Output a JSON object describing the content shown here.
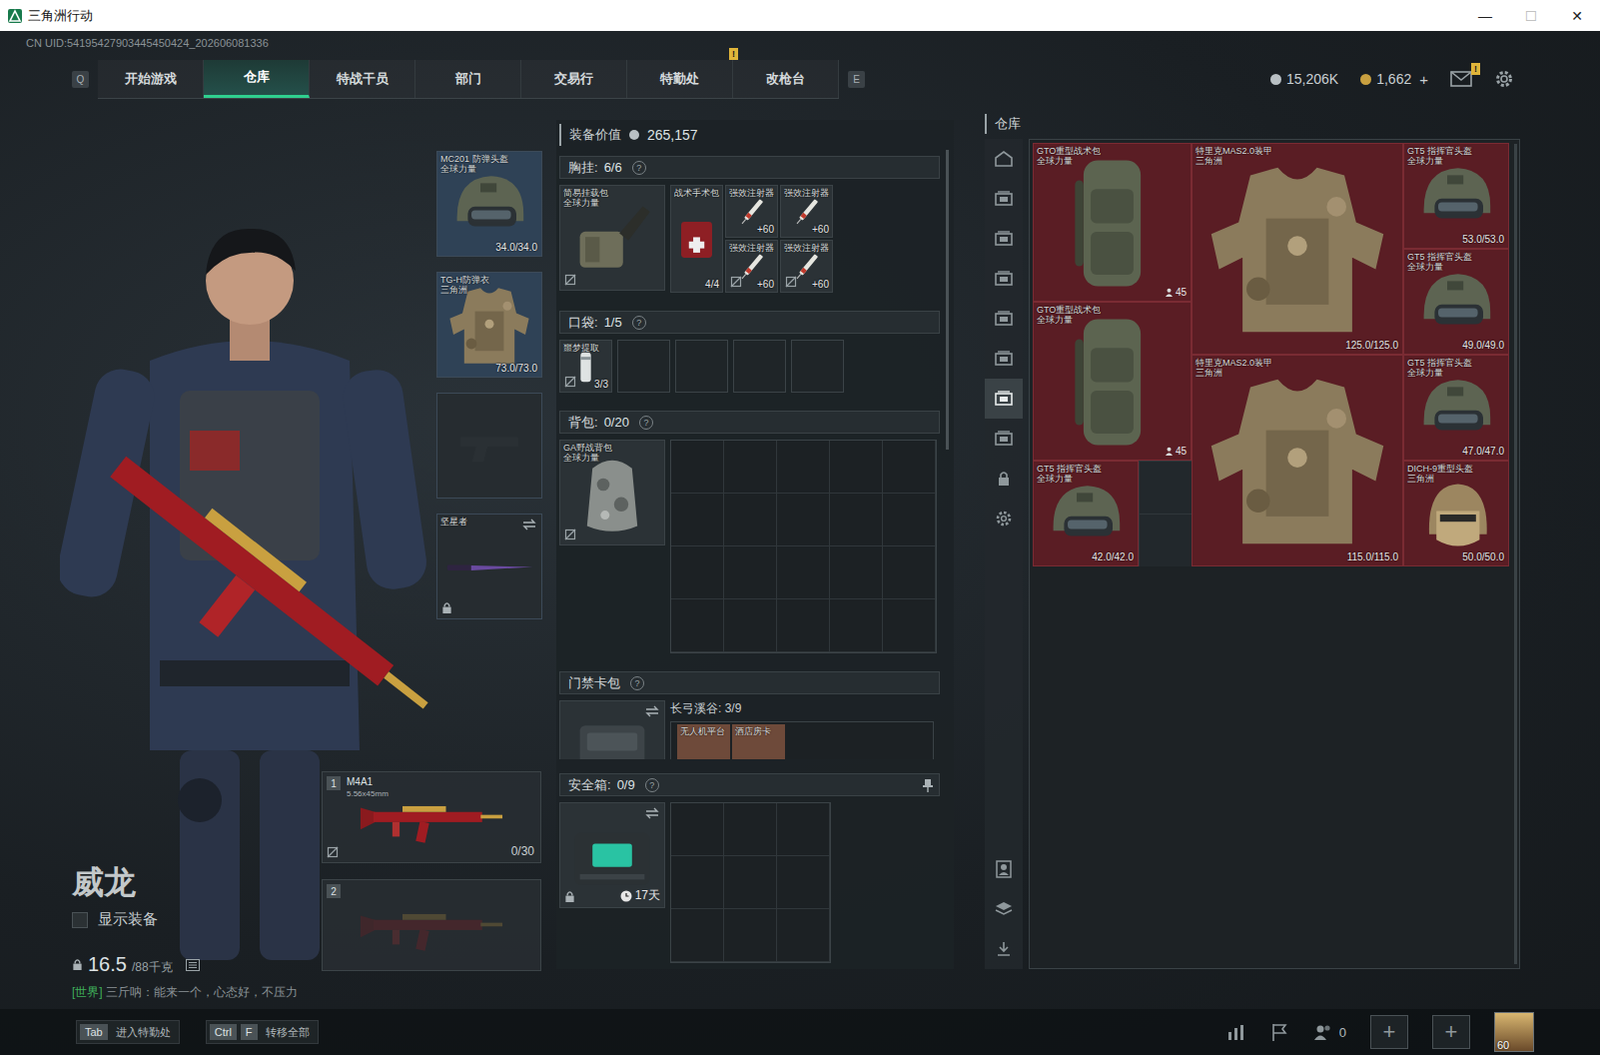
{
  "window": {
    "title": "三角洲行动",
    "controls": [
      {
        "glyph": "—",
        "disabled": false
      },
      {
        "glyph": "☐",
        "disabled": true
      },
      {
        "glyph": "✕",
        "disabled": false
      }
    ]
  },
  "uid": "CN UID:54195427903445450424_202606081336",
  "nav": {
    "prev_key": "Q",
    "next_key": "E",
    "tabs": [
      {
        "label": "开始游戏",
        "selected": false,
        "badge": ""
      },
      {
        "label": "仓库",
        "selected": true,
        "badge": ""
      },
      {
        "label": "特战干员",
        "selected": false,
        "badge": ""
      },
      {
        "label": "部门",
        "selected": false,
        "badge": ""
      },
      {
        "label": "交易行",
        "selected": false,
        "badge": ""
      },
      {
        "label": "特勤处",
        "selected": false,
        "badge": "!"
      },
      {
        "label": "改枪台",
        "selected": false,
        "badge": ""
      }
    ]
  },
  "currency": [
    {
      "kind": "silver",
      "amount": "15,206K",
      "action": ""
    },
    {
      "kind": "gold",
      "amount": "1,662",
      "action": "+"
    }
  ],
  "mail": {
    "badge": "!"
  },
  "character": {
    "name": "威龙",
    "show_gear": {
      "label": "显示装备",
      "checked": false
    },
    "weight": "16.5",
    "weight_max": "/88千克",
    "chat": {
      "channel": "[世界]",
      "text": "三斤呐：能来一个，心态好，不压力"
    }
  },
  "gear_slots": [
    {
      "kind": "helmet",
      "name": "MC201 防弹头盔",
      "sub": "全球力量",
      "reading": "34.0/34.0",
      "empty": false,
      "locked": false,
      "swap": false,
      "color": "#2f4256"
    },
    {
      "kind": "vest",
      "name": "TG-H防弹衣",
      "sub": "三角洲",
      "reading": "73.0/73.0",
      "empty": false,
      "locked": false,
      "swap": false,
      "color": "#2f4256"
    },
    {
      "kind": "pistol",
      "name": "",
      "sub": "",
      "reading": "",
      "empty": true,
      "locked": false,
      "swap": false,
      "color": "#262c30"
    },
    {
      "kind": "knife",
      "name": "坚星者",
      "sub": "",
      "reading": "",
      "empty": false,
      "locked": true,
      "swap": true,
      "color": "#262c30"
    }
  ],
  "weapons": [
    {
      "slot": "1",
      "name": "M4A1",
      "caliber": "5.56x45mm",
      "ammo": "0/30",
      "empty": false,
      "unsecured": true
    },
    {
      "slot": "2",
      "name": "",
      "caliber": "",
      "ammo": "",
      "empty": true,
      "unsecured": false
    }
  ],
  "loadout": {
    "value_label": "装备价值",
    "value": "265,157",
    "chest": {
      "label": "胸挂:",
      "count": "6/6",
      "help": "?",
      "container": {
        "name": "简易挂载包",
        "sub": "全球力量",
        "kind": "rig",
        "unsecured": true
      },
      "items": [
        {
          "name": "战术手术包",
          "kind": "medkit",
          "count": "4/4",
          "unsecured": false
        },
        {
          "name": "强效注射器",
          "kind": "injector",
          "count": "+60",
          "unsecured": false
        },
        {
          "name": "强效注射器",
          "kind": "injector",
          "count": "+60",
          "unsecured": false
        },
        {
          "name": "强效注射器",
          "kind": "injector",
          "count": "+60",
          "unsecured": true
        },
        {
          "name": "强效注射器",
          "kind": "injector",
          "count": "+60",
          "unsecured": true
        }
      ]
    },
    "pocket": {
      "label": "口袋:",
      "count": "1/5",
      "help": "?",
      "items": [
        {
          "name": "噩梦提取",
          "kind": "tube",
          "count": "3/3",
          "unsecured": true
        }
      ],
      "empty_slots": 4
    },
    "backpack": {
      "label": "背包:",
      "count": "0/20",
      "help": "?",
      "container": {
        "name": "GA野战背包",
        "sub": "全球力量",
        "kind": "field-pack",
        "unsecured": true
      },
      "empty_slots": 20
    },
    "keycards": {
      "label": "门禁卡包",
      "help": "?",
      "swap": true,
      "map": "长弓溪谷: 3/9",
      "cards": [
        {
          "name": "无人机平台"
        },
        {
          "name": "酒店房卡"
        }
      ]
    },
    "safe": {
      "label": "安全箱:",
      "count": "0/9",
      "help": "?",
      "timer": "17天",
      "locked": true,
      "swap": true,
      "pinned": true,
      "empty_slots": 9
    }
  },
  "warehouse": {
    "title": "仓库",
    "sidebar": [
      {
        "kind": "home",
        "selected": false
      },
      {
        "kind": "page",
        "selected": false
      },
      {
        "kind": "page",
        "selected": false
      },
      {
        "kind": "page",
        "selected": false
      },
      {
        "kind": "page",
        "selected": false
      },
      {
        "kind": "page",
        "selected": false
      },
      {
        "kind": "page",
        "selected": true
      },
      {
        "kind": "page",
        "selected": false
      },
      {
        "kind": "lock",
        "selected": false
      },
      {
        "kind": "settings",
        "selected": false
      }
    ],
    "sidebar_bottom": [
      {
        "kind": "operator"
      },
      {
        "kind": "layers"
      },
      {
        "kind": "transfer"
      }
    ],
    "items": [
      {
        "name": "GTO重型战术包",
        "sub": "全球力量",
        "kind": "backpack",
        "reading": "",
        "badge": "45",
        "color": "#5a1d24"
      },
      {
        "name": "特里克MAS2.0装甲",
        "sub": "三角洲",
        "kind": "armor",
        "reading": "125.0/125.0",
        "badge": "",
        "color": "#5a1d24"
      },
      {
        "name": "GT5 指挥官头盔",
        "sub": "全球力量",
        "kind": "helmet",
        "reading": "53.0/53.0",
        "badge": "",
        "color": "#5a1d24"
      },
      {
        "name": "GT5 指挥官头盔",
        "sub": "全球力量",
        "kind": "helmet",
        "reading": "49.0/49.0",
        "badge": "",
        "color": "#5a1d24"
      },
      {
        "name": "GTO重型战术包",
        "sub": "全球力量",
        "kind": "backpack",
        "reading": "",
        "badge": "45",
        "color": "#5a1d24"
      },
      {
        "name": "特里克MAS2.0装甲",
        "sub": "三角洲",
        "kind": "armor",
        "reading": "115.0/115.0",
        "badge": "",
        "color": "#5a1d24"
      },
      {
        "name": "GT5 指挥官头盔",
        "sub": "全球力量",
        "kind": "helmet",
        "reading": "47.0/47.0",
        "badge": "",
        "color": "#5a1d24"
      },
      {
        "name": "GT5 指挥官头盔",
        "sub": "全球力量",
        "kind": "helmet",
        "reading": "42.0/42.0",
        "badge": "",
        "color": "#5a1d24"
      },
      {
        "name": "DICH-9重型头盔",
        "sub": "三角洲",
        "kind": "heavy-helmet",
        "reading": "50.0/50.0",
        "badge": "",
        "color": "#5a1d24"
      }
    ]
  },
  "footer": {
    "hints": [
      {
        "keys": [
          "Tab"
        ],
        "label": "进入特勤处"
      },
      {
        "keys": [
          "Ctrl",
          "F"
        ],
        "label": "转移全部"
      }
    ],
    "friends": "0",
    "party_slots": [
      "+",
      "+"
    ],
    "level": "60"
  }
}
